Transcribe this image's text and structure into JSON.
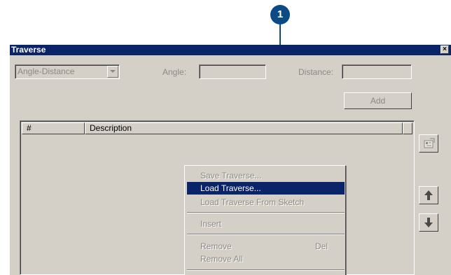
{
  "callout": {
    "number": "1"
  },
  "window": {
    "title": "Traverse",
    "close_glyph": "×"
  },
  "toolbar": {
    "mode_value": "Angle-Distance",
    "angle_label": "Angle:",
    "distance_label": "Distance:",
    "add_label": "Add"
  },
  "list": {
    "columns": [
      "#",
      "Description"
    ]
  },
  "side_buttons": {
    "properties_icon": "properties-icon",
    "up_icon": "up-arrow-icon",
    "down_icon": "down-arrow-icon"
  },
  "menu": {
    "items": [
      {
        "label": "Save Traverse...",
        "enabled": false
      },
      {
        "label": "Load Traverse...",
        "enabled": true,
        "highlighted": true
      },
      {
        "label": "Load Traverse From Sketch",
        "enabled": false
      },
      {
        "label": "Insert",
        "enabled": false
      },
      {
        "label": "Remove",
        "shortcut": "Del",
        "enabled": false
      },
      {
        "label": "Remove All",
        "enabled": false
      }
    ]
  },
  "colors": {
    "title_bar": "#0a246a",
    "highlight": "#0a246a",
    "callout": "#0c4a86",
    "face": "#d4d0c8",
    "disabled_text": "#8c8a84"
  }
}
